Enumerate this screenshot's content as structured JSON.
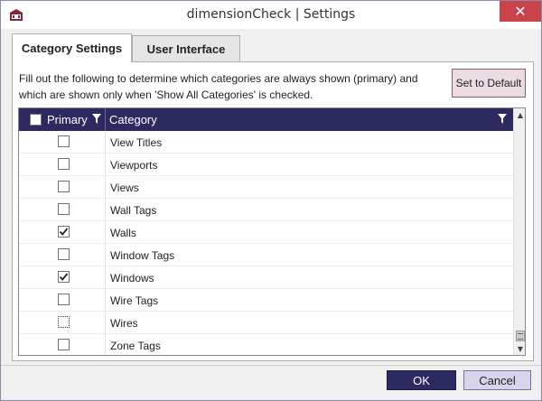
{
  "window": {
    "title": "dimensionCheck | Settings",
    "close_label": "✕",
    "app_icon": "app-logo-icon"
  },
  "tabs": [
    {
      "label": "Category Settings",
      "active": true
    },
    {
      "label": "User Interface",
      "active": false
    }
  ],
  "panel": {
    "description": "Fill out the following to determine which categories are always shown (primary) and which are shown only when 'Show All Categories' is checked.",
    "default_button": "Set to Default"
  },
  "grid": {
    "columns": [
      "Primary",
      "Category"
    ],
    "filter_icon": "filter-icon",
    "header_checked": false,
    "rows": [
      {
        "primary": false,
        "category": "View Titles"
      },
      {
        "primary": false,
        "category": "Viewports"
      },
      {
        "primary": false,
        "category": "Views"
      },
      {
        "primary": false,
        "category": "Wall Tags"
      },
      {
        "primary": true,
        "category": "Walls"
      },
      {
        "primary": false,
        "category": "Window Tags"
      },
      {
        "primary": true,
        "category": "Windows"
      },
      {
        "primary": false,
        "category": "Wire Tags"
      },
      {
        "primary": false,
        "category": "Wires",
        "focused": true
      },
      {
        "primary": false,
        "category": "Zone Tags"
      }
    ]
  },
  "footer": {
    "ok_label": "OK",
    "cancel_label": "Cancel"
  },
  "colors": {
    "header_bg": "#2d2a61",
    "close_bg": "#c9434a",
    "default_btn_bg": "#e9dce3",
    "cancel_bg": "#d7d4eb"
  }
}
